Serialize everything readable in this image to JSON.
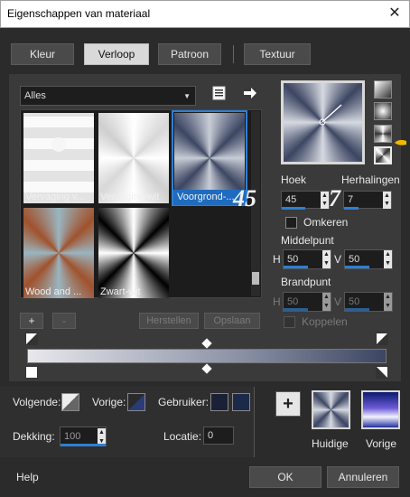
{
  "window": {
    "title": "Eigenschappen van materiaal",
    "close_glyph": "✕"
  },
  "tabs": [
    {
      "label": "Kleur"
    },
    {
      "label": "Verloop"
    },
    {
      "label": "Patroon"
    },
    {
      "label": "Textuur"
    }
  ],
  "filter": {
    "value": "Alles",
    "arrow": "▼"
  },
  "gallery": [
    {
      "caption": "Vervaging v..."
    },
    {
      "caption": "Vervaging wit"
    },
    {
      "caption": "Voorgrond-..."
    },
    {
      "caption": "Wood and ..."
    },
    {
      "caption": "Zwart-wit"
    }
  ],
  "gallery_buttons": {
    "add": "+",
    "remove": "-",
    "reset": "Herstellen",
    "save": "Opslaan"
  },
  "angle": {
    "label": "Hoek",
    "value": "45",
    "overlay": "45"
  },
  "repeats": {
    "label": "Herhalingen",
    "value": "7",
    "overlay": "7"
  },
  "invert": {
    "label": "Omkeren"
  },
  "center": {
    "label": "Middelpunt",
    "h_label": "H",
    "h_value": "50",
    "v_label": "V",
    "v_value": "50"
  },
  "focus": {
    "label": "Brandpunt",
    "h_label": "H",
    "h_value": "50",
    "v_label": "V",
    "v_value": "50"
  },
  "link": {
    "label": "Koppelen"
  },
  "colors": {
    "next_label": "Volgende:",
    "prev_label": "Vorige:",
    "user_label": "Gebruiker:",
    "user_swatch_1": "#1a2035",
    "user_swatch_2": "#1c2a4a"
  },
  "opacity": {
    "label": "Dekking:",
    "value": "100"
  },
  "location": {
    "label": "Locatie:",
    "value": "0"
  },
  "current": {
    "label": "Huidige"
  },
  "previous": {
    "label": "Vorige"
  },
  "footer": {
    "help": "Help",
    "ok": "OK",
    "cancel": "Annuleren"
  },
  "spin_up": "▲",
  "spin_down": "▼"
}
